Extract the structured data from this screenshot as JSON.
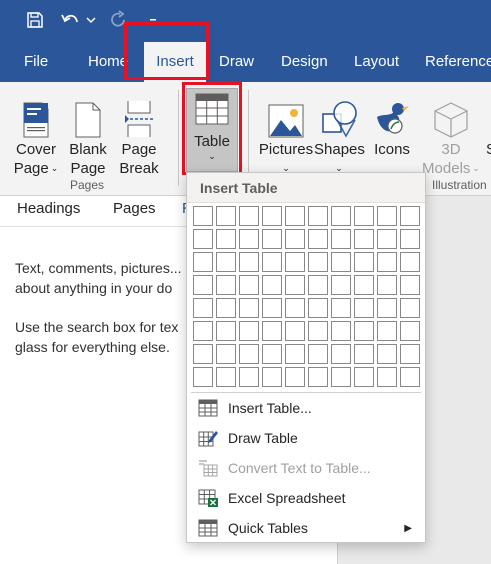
{
  "colors": {
    "accent": "#2b579a",
    "highlight": "#e81123",
    "excel_green": "#1d6f42"
  },
  "quick_access": {
    "save_icon": "save-icon",
    "undo_icon": "undo-icon",
    "undo_dropdown": "chevron-down-icon",
    "redo_icon": "redo-icon"
  },
  "tabs": [
    "File",
    "Home",
    "Insert",
    "Draw",
    "Design",
    "Layout",
    "Reference"
  ],
  "active_tab": "Insert",
  "ribbon": {
    "cover_page": {
      "line1": "Cover",
      "line2": "Page",
      "icon": "cover-page-icon"
    },
    "blank_page": {
      "line1": "Blank",
      "line2": "Page",
      "icon": "blank-page-icon"
    },
    "page_break": {
      "line1": "Page",
      "line2": "Break",
      "icon": "page-break-icon"
    },
    "pages_group": "Pages",
    "table": {
      "label": "Table",
      "icon": "table-icon"
    },
    "pictures": {
      "label": "Pictures",
      "icon": "pictures-icon"
    },
    "shapes": {
      "label": "Shapes",
      "icon": "shapes-icon"
    },
    "icons": {
      "label": "Icons",
      "icon": "icons-icon"
    },
    "models_3d": {
      "line1": "3D",
      "line2": "Models",
      "icon": "3d-models-icon"
    },
    "illustrations_group": "Illustration",
    "clipped_glyph": "S"
  },
  "nav_pane": {
    "tabs": [
      "Headings",
      "Pages"
    ],
    "clipped_tab_glyph": "R",
    "paragraph1_line1": "Text, comments, pictures...",
    "paragraph1_line2": "about anything in your do",
    "paragraph2_line1": "Use the search box for tex",
    "paragraph2_line2": "glass for everything else."
  },
  "insert_table_menu": {
    "header": "Insert Table",
    "grid_columns": 10,
    "grid_rows": 8,
    "items": [
      {
        "label": "Insert Table...",
        "icon": "insert-table-icon",
        "enabled": true
      },
      {
        "label": "Draw Table",
        "icon": "draw-table-icon",
        "enabled": true
      },
      {
        "label": "Convert Text to Table...",
        "icon": "convert-text-to-table-icon",
        "enabled": false
      },
      {
        "label": "Excel Spreadsheet",
        "icon": "excel-spreadsheet-icon",
        "enabled": true
      },
      {
        "label": "Quick Tables",
        "icon": "quick-tables-icon",
        "enabled": true,
        "submenu": true
      }
    ]
  }
}
